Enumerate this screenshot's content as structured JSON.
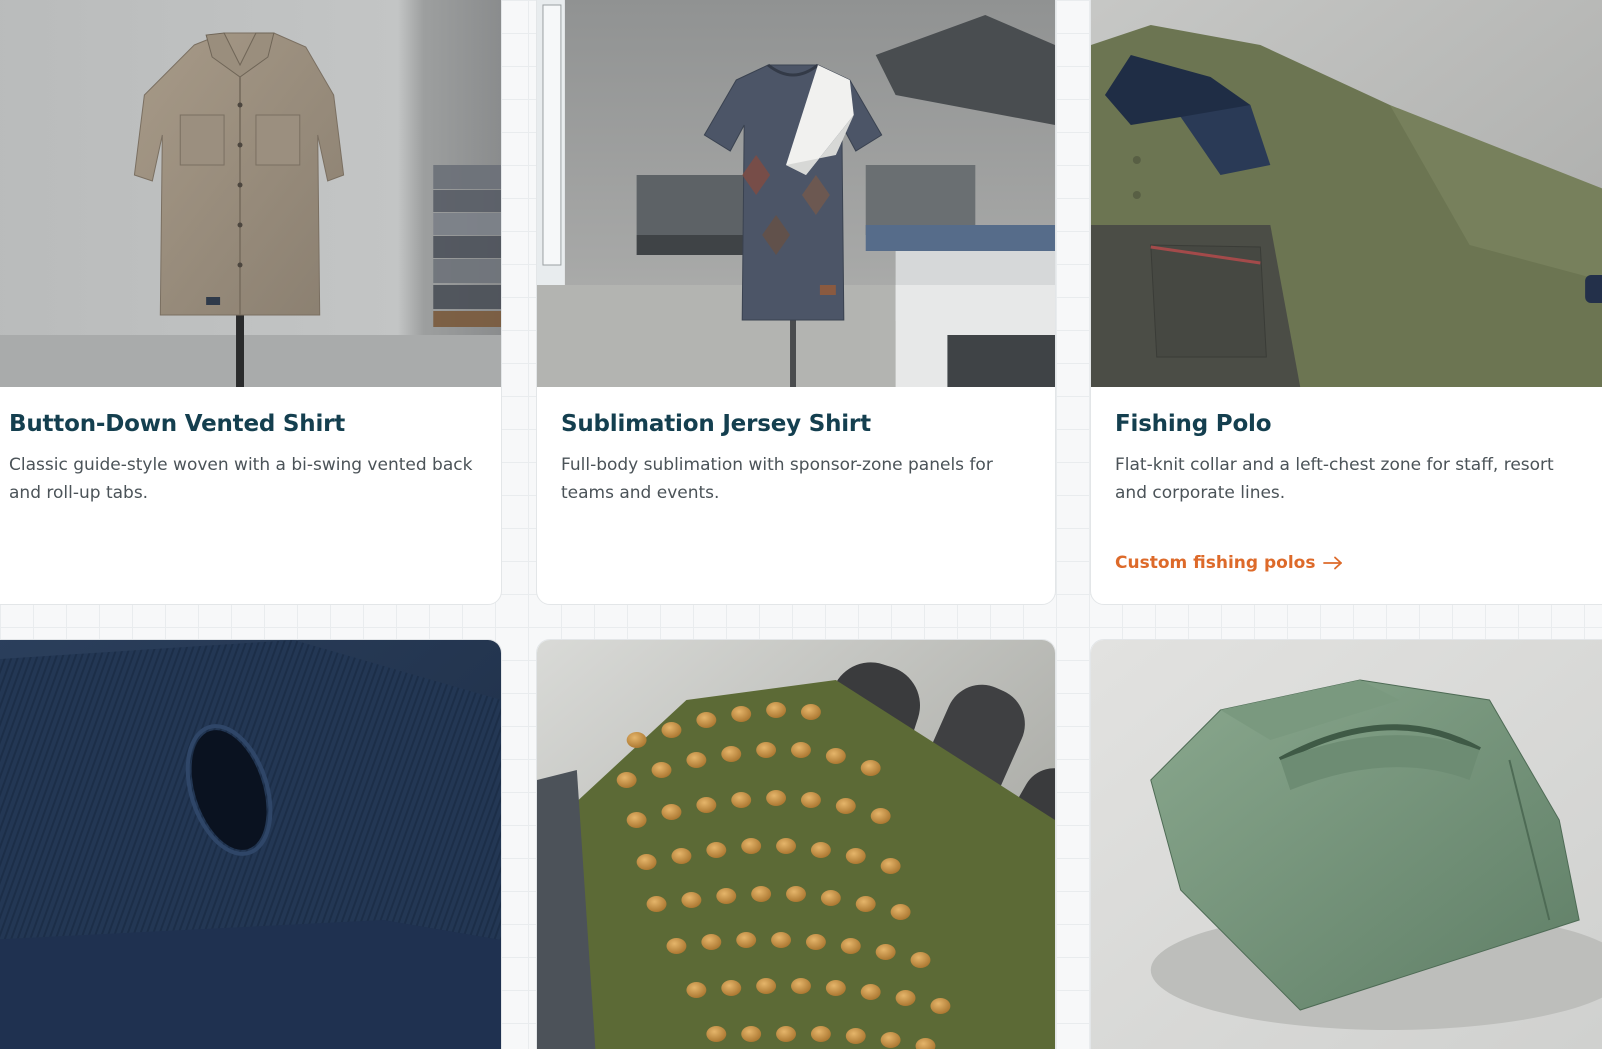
{
  "cards": [
    {
      "title": "Button-Down Vented Shirt",
      "description": "Classic guide-style woven with a bi-swing vented back and roll-up tabs.",
      "image_alt": "Tan button-down vented shirt on a mannequin in a factory"
    },
    {
      "title": "Sublimation Jersey Shirt",
      "description": "Full-body sublimation with sponsor-zone panels for teams and events.",
      "image_alt": "Navy heather jersey on a mannequin next to a heat press"
    },
    {
      "title": "Fishing Polo",
      "description": "Flat-knit collar and a left-chest zone for staff, resort and corporate lines.",
      "link_label": "Custom fishing polos",
      "link_icon": "arrow-right-icon",
      "image_alt": "Olive fishing polo with navy collar and chest pocket"
    },
    {
      "image_alt": "Navy knit sleeve cuff with thumbhole"
    },
    {
      "image_alt": "Olive knit glove with amber silicone grip dots"
    },
    {
      "image_alt": "Folded sage green shirt with vented back yoke"
    }
  ],
  "colors": {
    "title": "#143f4f",
    "description": "#4b5358",
    "link": "#dd6a2a",
    "card_border": "#e3e6e8"
  }
}
